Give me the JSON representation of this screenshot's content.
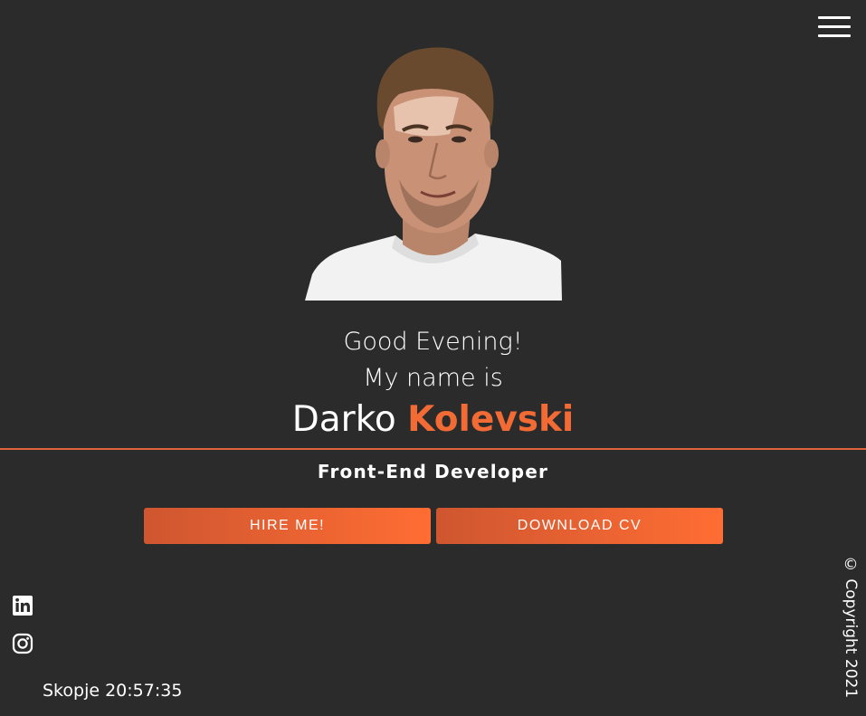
{
  "nav": {
    "menu_icon": "hamburger-menu-icon"
  },
  "hero": {
    "greeting_line1": "Good Evening!",
    "greeting_line2": "My name is",
    "first_name": "Darko",
    "last_name": "Kolevski",
    "role": "Front-End Developer",
    "accent_color": "#f26a34",
    "background_color": "#2b2b2b"
  },
  "actions": {
    "hire_label": "HIRE ME!",
    "cv_label": "DOWNLOAD CV"
  },
  "social": {
    "items": [
      {
        "icon": "linkedin-icon"
      },
      {
        "icon": "instagram-icon"
      }
    ]
  },
  "footer": {
    "clock_text": "Skopje 20:57:35",
    "copyright": "© Copyright 2021"
  }
}
